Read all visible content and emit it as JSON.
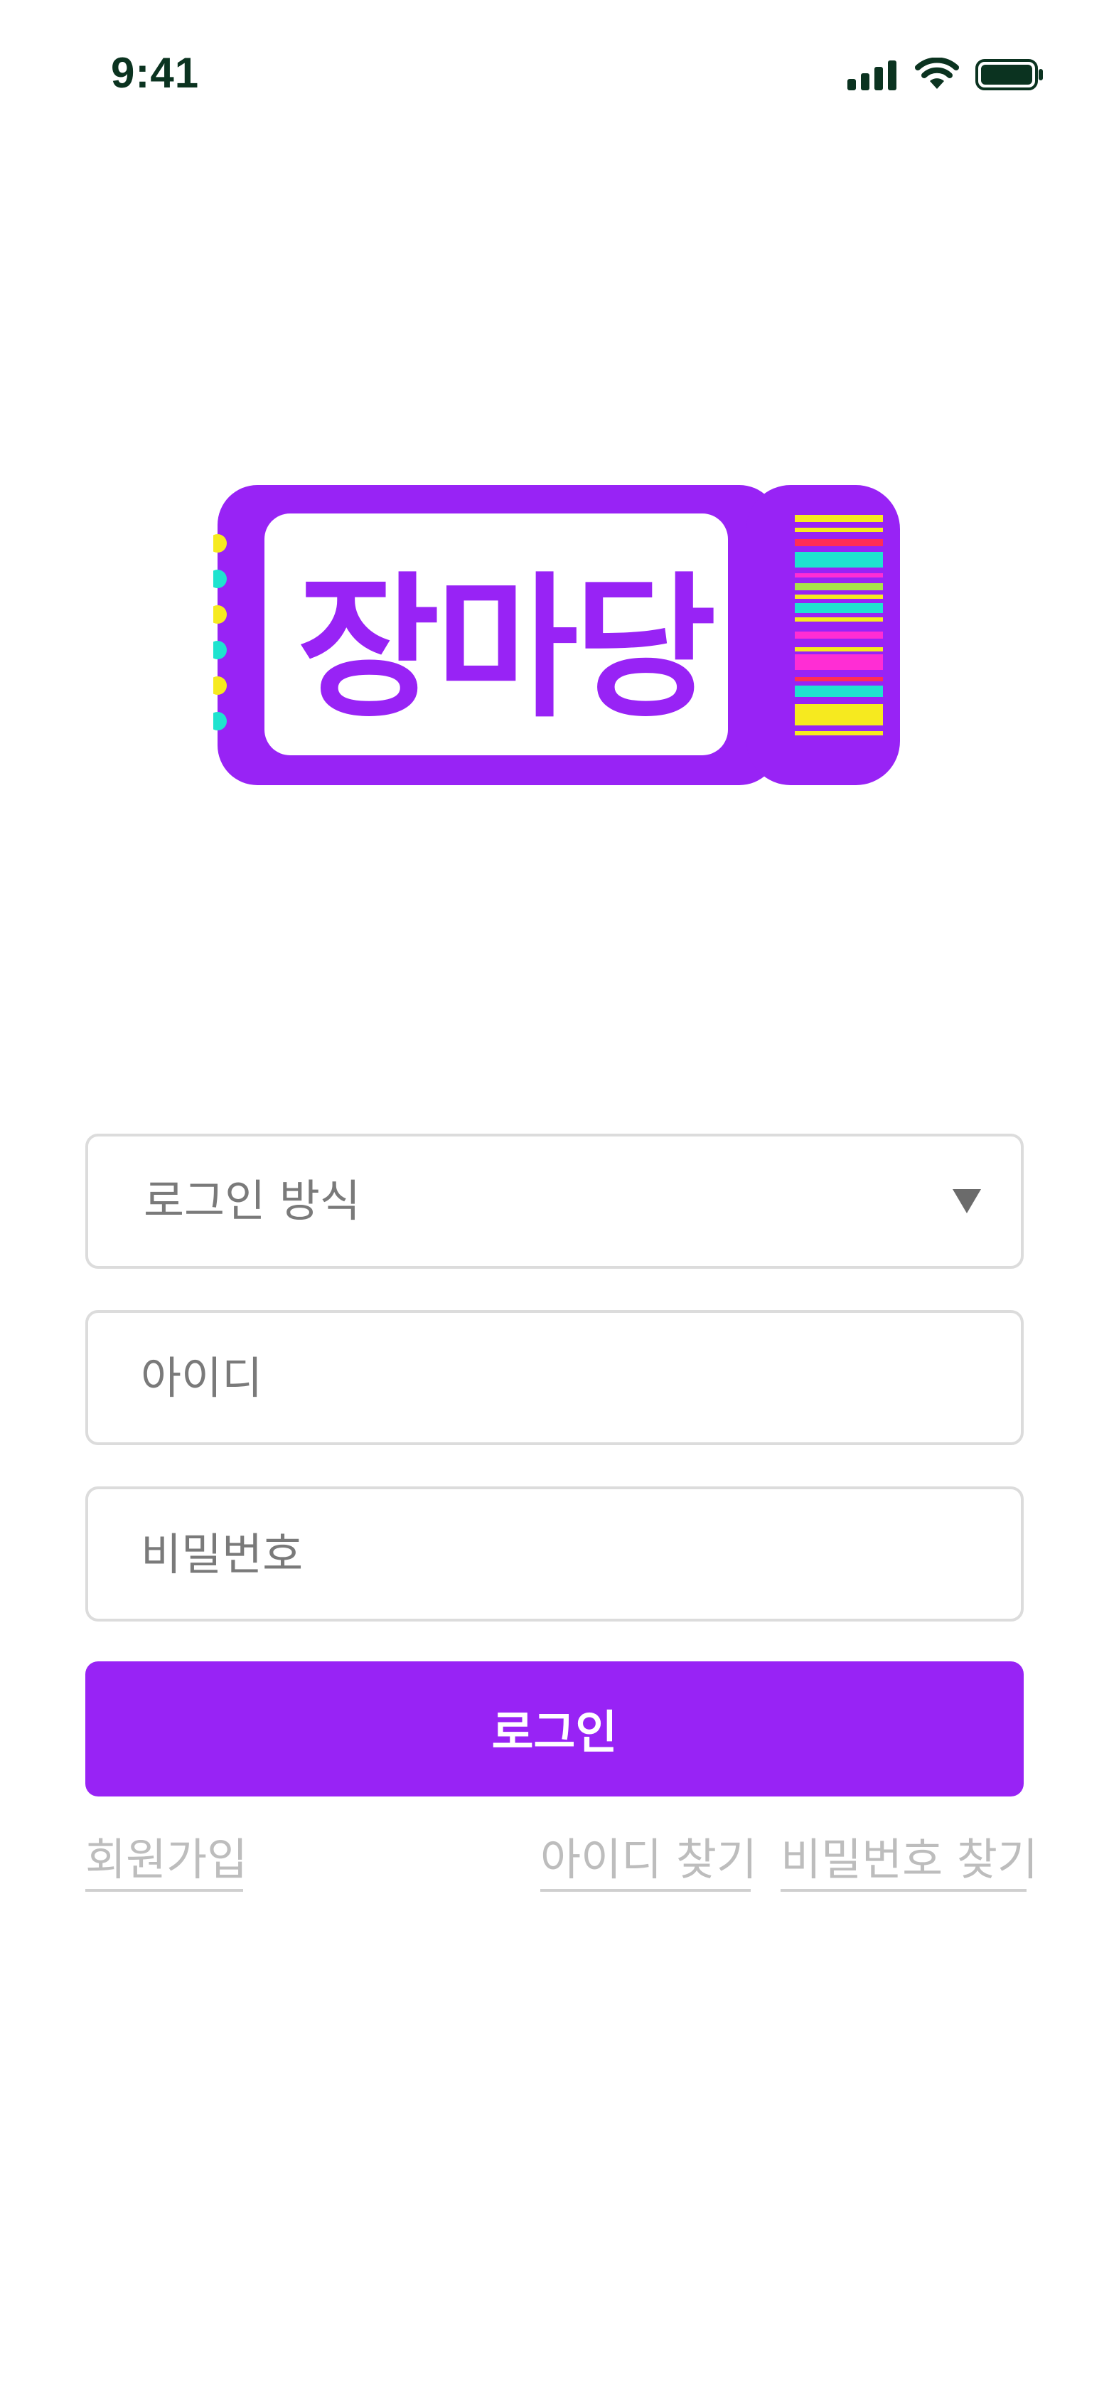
{
  "status_bar": {
    "time": "9:41",
    "icons": [
      "signal-icon",
      "wifi-icon",
      "battery-icon"
    ]
  },
  "logo": {
    "text": "장마당",
    "colors": {
      "ticket": "#9823f5",
      "stripes": [
        "#f6ea1f",
        "#ff2d55",
        "#1ee3cf",
        "#ff2dd4"
      ]
    }
  },
  "form": {
    "login_method": {
      "value": "로그인 방식"
    },
    "user_id": {
      "placeholder": "아이디"
    },
    "password": {
      "placeholder": "비밀번호"
    },
    "submit_label": "로그인"
  },
  "links": {
    "signup": "회원가입",
    "find_id": "아이디 찾기",
    "find_password": "비밀번호 찾기"
  },
  "colors": {
    "accent": "#9823f5",
    "border": "#dcdcdc",
    "placeholder": "#7a7a7a",
    "link": "#bdbdbd"
  }
}
